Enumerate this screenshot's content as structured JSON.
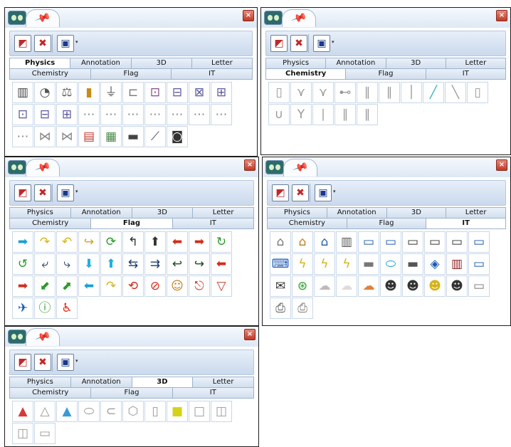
{
  "close_glyph": "×",
  "tabs_row1": [
    "Physics",
    "Annotation",
    "3D",
    "Letter"
  ],
  "tabs_row2": [
    "Chemistry",
    "Flag",
    "IT"
  ],
  "toolbar_icons": [
    "bookmark-red-icon",
    "delete-red-icon",
    "save-disk-icon",
    "dropdown-arrow-icon"
  ],
  "windows": [
    {
      "id": "physics",
      "active_tab": "Physics",
      "icons": [
        {
          "name": "battery-stack-icon",
          "glyph": "▥",
          "color": "#444"
        },
        {
          "name": "meter-icon",
          "glyph": "◔",
          "color": "#555"
        },
        {
          "name": "scale-icon",
          "glyph": "⚖",
          "color": "#666"
        },
        {
          "name": "battery-cell-icon",
          "glyph": "▮",
          "color": "#c88a1a"
        },
        {
          "name": "switch-icon",
          "glyph": "⏚",
          "color": "#555"
        },
        {
          "name": "circuit-icon",
          "glyph": "⊏",
          "color": "#777"
        },
        {
          "name": "circuit-icon",
          "glyph": "⊡",
          "color": "#8a4a8a"
        },
        {
          "name": "circuit-icon",
          "glyph": "⊟",
          "color": "#5a5aa0"
        },
        {
          "name": "circuit-icon",
          "glyph": "⊠",
          "color": "#5a5aa0"
        },
        {
          "name": "circuit-icon",
          "glyph": "⊞",
          "color": "#5a5aa0"
        },
        {
          "name": "circuit-icon",
          "glyph": "⊡",
          "color": "#5a5aa0"
        },
        {
          "name": "circuit-icon",
          "glyph": "⊟",
          "color": "#5a5aa0"
        },
        {
          "name": "circuit-icon",
          "glyph": "⊞",
          "color": "#5a5aa0"
        },
        {
          "name": "wire-icon",
          "glyph": "⋯",
          "color": "#888"
        },
        {
          "name": "wire-icon",
          "glyph": "⋯",
          "color": "#888"
        },
        {
          "name": "wire-icon",
          "glyph": "⋯",
          "color": "#888"
        },
        {
          "name": "wire-icon",
          "glyph": "⋯",
          "color": "#888"
        },
        {
          "name": "wire-icon",
          "glyph": "⋯",
          "color": "#888"
        },
        {
          "name": "wire-icon",
          "glyph": "⋯",
          "color": "#888"
        },
        {
          "name": "wire-icon",
          "glyph": "⋯",
          "color": "#888"
        },
        {
          "name": "wire-icon",
          "glyph": "⋯",
          "color": "#888"
        },
        {
          "name": "lens-icon",
          "glyph": "⋈",
          "color": "#888"
        },
        {
          "name": "lens-icon",
          "glyph": "⋈",
          "color": "#888"
        },
        {
          "name": "magnet-icon",
          "glyph": "▤",
          "color": "#c0392b"
        },
        {
          "name": "device-icon",
          "glyph": "▦",
          "color": "#4a8a4a"
        },
        {
          "name": "device-icon",
          "glyph": "▬",
          "color": "#444"
        },
        {
          "name": "lever-icon",
          "glyph": "⟋",
          "color": "#444"
        },
        {
          "name": "ammeter-icon",
          "glyph": "◙",
          "color": "#333"
        }
      ]
    },
    {
      "id": "chemistry",
      "active_tab": "Chemistry",
      "icons": [
        {
          "name": "glass-tube-icon",
          "glyph": "▯",
          "color": "#999"
        },
        {
          "name": "funnel-icon",
          "glyph": "⋎",
          "color": "#999"
        },
        {
          "name": "funnel-icon",
          "glyph": "⋎",
          "color": "#999"
        },
        {
          "name": "pipe-icon",
          "glyph": "⊷",
          "color": "#999"
        },
        {
          "name": "tube-rack-icon",
          "glyph": "∥",
          "color": "#999"
        },
        {
          "name": "tube-rack-icon",
          "glyph": "∥",
          "color": "#999"
        },
        {
          "name": "thermometer-icon",
          "glyph": "│",
          "color": "#999"
        },
        {
          "name": "rod-icon",
          "glyph": "╱",
          "color": "#3ab0c0"
        },
        {
          "name": "pipette-icon",
          "glyph": "╲",
          "color": "#999"
        },
        {
          "name": "test-tube-icon",
          "glyph": "▯",
          "color": "#999"
        },
        {
          "name": "test-tube-icon",
          "glyph": "∪",
          "color": "#999"
        },
        {
          "name": "funnel-icon",
          "glyph": "Y",
          "color": "#999"
        },
        {
          "name": "tube-icon",
          "glyph": "∣",
          "color": "#999"
        },
        {
          "name": "tube-icon",
          "glyph": "∥",
          "color": "#999"
        },
        {
          "name": "tube-icon",
          "glyph": "∥",
          "color": "#999"
        }
      ]
    },
    {
      "id": "flag",
      "active_tab": "Flag",
      "icons": [
        {
          "name": "arrow-right-icon",
          "glyph": "➡",
          "color": "#1a9fd6"
        },
        {
          "name": "curved-arrow-icon",
          "glyph": "↷",
          "color": "#d6b21a"
        },
        {
          "name": "curved-arrow-icon",
          "glyph": "↶",
          "color": "#d6b21a"
        },
        {
          "name": "curved-arrow-icon",
          "glyph": "↪",
          "color": "#d6a01a"
        },
        {
          "name": "cycle-arrow-icon",
          "glyph": "⟳",
          "color": "#2a9a2a"
        },
        {
          "name": "turn-arrow-icon",
          "glyph": "↰",
          "color": "#333"
        },
        {
          "name": "arrow-up-icon",
          "glyph": "⬆",
          "color": "#333"
        },
        {
          "name": "arrow-left-icon",
          "glyph": "⬅",
          "color": "#d62a1a"
        },
        {
          "name": "arrow-right-icon",
          "glyph": "➡",
          "color": "#d62a1a"
        },
        {
          "name": "u-turn-arrow-icon",
          "glyph": "↻",
          "color": "#2a9a2a"
        },
        {
          "name": "u-turn-arrow-icon",
          "glyph": "↺",
          "color": "#2a9a2a"
        },
        {
          "name": "split-arrow-icon",
          "glyph": "⤶",
          "color": "#1a3a6a"
        },
        {
          "name": "split-arrow-icon",
          "glyph": "⤷",
          "color": "#1a3a6a"
        },
        {
          "name": "arrow-down-icon",
          "glyph": "⬇",
          "color": "#1ab0e0"
        },
        {
          "name": "arrow-up-icon",
          "glyph": "⬆",
          "color": "#1ab0e0"
        },
        {
          "name": "double-arrow-icon",
          "glyph": "⇆",
          "color": "#1a3a6a"
        },
        {
          "name": "double-arrow-icon",
          "glyph": "⇉",
          "color": "#1a3a6a"
        },
        {
          "name": "curved-arrow-icon",
          "glyph": "↩",
          "color": "#1a4a1a"
        },
        {
          "name": "curved-arrow-icon",
          "glyph": "↪",
          "color": "#1a4a1a"
        },
        {
          "name": "arrow-left-icon",
          "glyph": "⬅",
          "color": "#d62a1a"
        },
        {
          "name": "arrow-right-icon",
          "glyph": "➡",
          "color": "#d62a1a"
        },
        {
          "name": "diagonal-arrow-icon",
          "glyph": "⬋",
          "color": "#2a9a2a"
        },
        {
          "name": "diagonal-arrow-icon",
          "glyph": "⬈",
          "color": "#2a9a2a"
        },
        {
          "name": "arrow-left-icon",
          "glyph": "⬅",
          "color": "#1a9fd6"
        },
        {
          "name": "curved-arrow-icon",
          "glyph": "↷",
          "color": "#d6b21a"
        },
        {
          "name": "cycle-arrow-icon",
          "glyph": "⟲",
          "color": "#d62a1a"
        },
        {
          "name": "no-sign-icon",
          "glyph": "⊘",
          "color": "#d62a1a"
        },
        {
          "name": "person-sign-icon",
          "glyph": "☺",
          "color": "#c07a1a"
        },
        {
          "name": "exit-sign-icon",
          "glyph": "⎋",
          "color": "#c0392b"
        },
        {
          "name": "yield-sign-icon",
          "glyph": "▽",
          "color": "#c0392b"
        },
        {
          "name": "airport-sign-icon",
          "glyph": "✈",
          "color": "#1a5ab0"
        },
        {
          "name": "info-sign-icon",
          "glyph": "ⓘ",
          "color": "#2a9a2a"
        },
        {
          "name": "handicap-sign-icon",
          "glyph": "♿",
          "color": "#d62a1a"
        }
      ]
    },
    {
      "id": "it",
      "active_tab": "IT",
      "icons": [
        {
          "name": "building-icon",
          "glyph": "⌂",
          "color": "#777"
        },
        {
          "name": "house-icon",
          "glyph": "⌂",
          "color": "#c07a1a"
        },
        {
          "name": "house-icon",
          "glyph": "⌂",
          "color": "#1a5ab0"
        },
        {
          "name": "server-icon",
          "glyph": "▥",
          "color": "#555"
        },
        {
          "name": "computer-icon",
          "glyph": "▭",
          "color": "#1a5ab0"
        },
        {
          "name": "computer-icon",
          "glyph": "▭",
          "color": "#1a5ab0"
        },
        {
          "name": "computer-icon",
          "glyph": "▭",
          "color": "#333"
        },
        {
          "name": "computer-icon",
          "glyph": "▭",
          "color": "#333"
        },
        {
          "name": "computer-icon",
          "glyph": "▭",
          "color": "#333"
        },
        {
          "name": "computer-icon",
          "glyph": "▭",
          "color": "#1a5ab0"
        },
        {
          "name": "laptop-icon",
          "glyph": "⌨",
          "color": "#1a5ab0"
        },
        {
          "name": "lightning-icon",
          "glyph": "ϟ",
          "color": "#d6b21a"
        },
        {
          "name": "lightning-icon",
          "glyph": "ϟ",
          "color": "#d6b21a"
        },
        {
          "name": "lightning-icon",
          "glyph": "ϟ",
          "color": "#d6b21a"
        },
        {
          "name": "switch-icon",
          "glyph": "▬",
          "color": "#777"
        },
        {
          "name": "router-icon",
          "glyph": "⬭",
          "color": "#1a9fd6"
        },
        {
          "name": "switch-icon",
          "glyph": "▬",
          "color": "#555"
        },
        {
          "name": "router-icon",
          "glyph": "◈",
          "color": "#1a5ab0"
        },
        {
          "name": "firewall-icon",
          "glyph": "▥",
          "color": "#8a1a1a"
        },
        {
          "name": "scanner-icon",
          "glyph": "▭",
          "color": "#1a5ab0"
        },
        {
          "name": "mail-icon",
          "glyph": "✉",
          "color": "#333"
        },
        {
          "name": "satellite-icon",
          "glyph": "⊛",
          "color": "#2a9a2a"
        },
        {
          "name": "cloud-icon",
          "glyph": "☁",
          "color": "#bbb"
        },
        {
          "name": "cloud-icon",
          "glyph": "☁",
          "color": "#ddd"
        },
        {
          "name": "cloud-icon",
          "glyph": "☁",
          "color": "#e0803a"
        },
        {
          "name": "user-desk-icon",
          "glyph": "☻",
          "color": "#333"
        },
        {
          "name": "user-desk-icon",
          "glyph": "☻",
          "color": "#333"
        },
        {
          "name": "user-desk-icon",
          "glyph": "☻",
          "color": "#d6b21a"
        },
        {
          "name": "user-desk-icon",
          "glyph": "☻",
          "color": "#333"
        },
        {
          "name": "scanner-icon",
          "glyph": "▭",
          "color": "#777"
        },
        {
          "name": "printer-icon",
          "glyph": "⎙",
          "color": "#555"
        },
        {
          "name": "printer-icon",
          "glyph": "⎙",
          "color": "#777"
        }
      ]
    },
    {
      "id": "3d",
      "active_tab": "3D",
      "icons": [
        {
          "name": "pyramid-icon",
          "glyph": "▲",
          "color": "#d63a3a"
        },
        {
          "name": "cone-icon",
          "glyph": "△",
          "color": "#999"
        },
        {
          "name": "pyramid-icon",
          "glyph": "▲",
          "color": "#3a9ad6"
        },
        {
          "name": "cylinder-icon",
          "glyph": "⬭",
          "color": "#999"
        },
        {
          "name": "cylinder-icon",
          "glyph": "⊂",
          "color": "#999"
        },
        {
          "name": "prism-icon",
          "glyph": "⬡",
          "color": "#999"
        },
        {
          "name": "cylinder-icon",
          "glyph": "▯",
          "color": "#999"
        },
        {
          "name": "cube-icon",
          "glyph": "■",
          "color": "#d6d21a"
        },
        {
          "name": "cube-icon",
          "glyph": "□",
          "color": "#999"
        },
        {
          "name": "frame-icon",
          "glyph": "◫",
          "color": "#999"
        },
        {
          "name": "frame-icon",
          "glyph": "◫",
          "color": "#999"
        },
        {
          "name": "frame-icon",
          "glyph": "▭",
          "color": "#999"
        }
      ]
    }
  ]
}
